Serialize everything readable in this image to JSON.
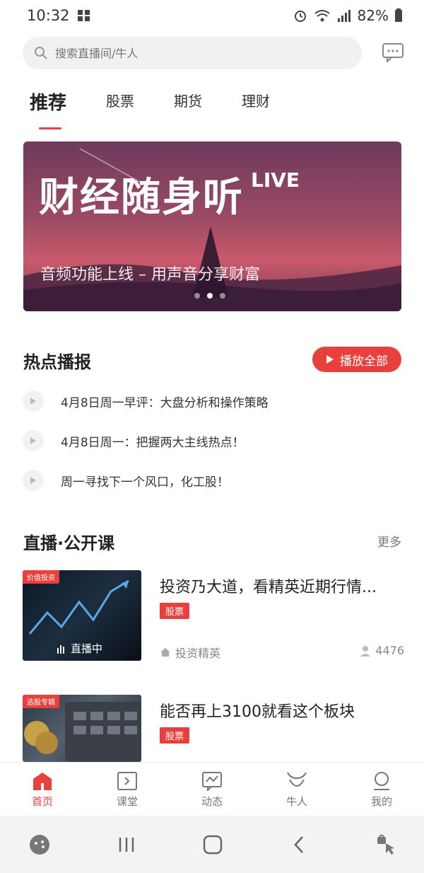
{
  "status_bar": {
    "time": "10:32",
    "battery": "82%"
  },
  "search": {
    "placeholder": "搜索直播间/牛人"
  },
  "tabs": [
    {
      "label": "推荐"
    },
    {
      "label": "股票"
    },
    {
      "label": "期货"
    },
    {
      "label": "理财"
    }
  ],
  "banner": {
    "title": "财经随身听",
    "title_suffix": "LIVE",
    "subtitle": "音频功能上线 – 用声音分享财富"
  },
  "hot_news": {
    "title": "热点播报",
    "play_all_label": "播放全部",
    "items": [
      {
        "text": "4月8日周一早评：大盘分析和操作策略"
      },
      {
        "text": "4月8日周一：把握两大主线热点！"
      },
      {
        "text": "周一寻找下一个风口，化工股！"
      }
    ]
  },
  "live_section": {
    "title": "直播·公开课",
    "more_label": "更多",
    "courses": [
      {
        "thumb_tag": "价值投资",
        "thumb_live_label": "直播中",
        "title": "投资乃大道，看精英近期行情...",
        "badge": "股票",
        "author": "投资精英",
        "viewers": "4476"
      },
      {
        "thumb_tag": "选股专辑",
        "title": "能否再上3100就看这个板块",
        "badge": "股票"
      }
    ]
  },
  "bottom_nav": [
    {
      "label": "首页"
    },
    {
      "label": "课堂"
    },
    {
      "label": "动态"
    },
    {
      "label": "牛人"
    },
    {
      "label": "我的"
    }
  ],
  "colors": {
    "accent": "#e8413d",
    "text_primary": "#222222",
    "text_secondary": "#777777"
  }
}
